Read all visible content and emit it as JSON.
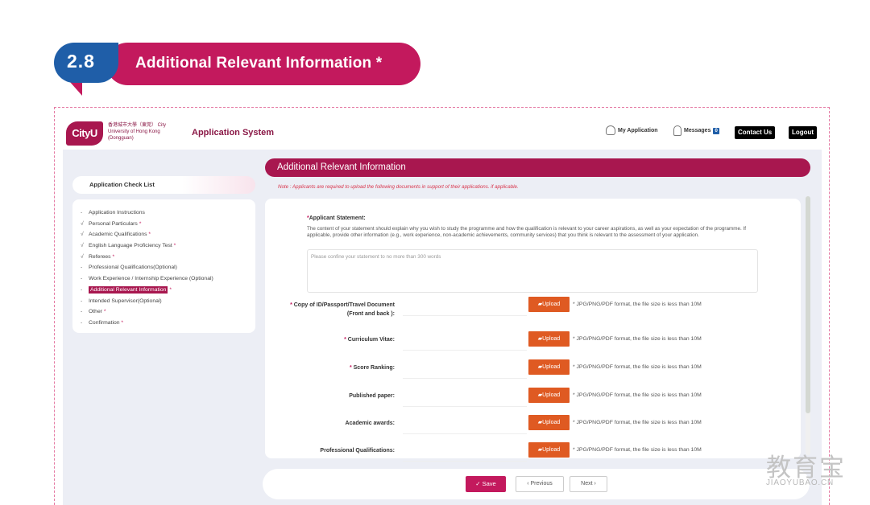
{
  "section": {
    "number": "2.8",
    "title": "Additional Relevant Information *"
  },
  "header": {
    "logo_text": "CityU",
    "logo_subtitle": "香港城市大學（東莞） City University of Hong Kong (Dongguan)",
    "app_title": "Application System",
    "my_application": "My Application",
    "messages": "Messages",
    "messages_count": "0",
    "contact_us": "Contact Us",
    "logout": "Logout"
  },
  "sidebar": {
    "title": "Application Check List",
    "items": [
      {
        "mark": "-",
        "label": "Application Instructions",
        "required": "",
        "active": false
      },
      {
        "mark": "√",
        "label": "Personal Particulars",
        "required": " *",
        "active": false
      },
      {
        "mark": "√",
        "label": "Academic Qualifications",
        "required": " *",
        "active": false
      },
      {
        "mark": "√",
        "label": "English Language Proficiency Test",
        "required": " *",
        "active": false
      },
      {
        "mark": "√",
        "label": "Referees",
        "required": " *",
        "active": false
      },
      {
        "mark": "-",
        "label": "Professional Qualifications(Optional)",
        "required": "",
        "active": false
      },
      {
        "mark": "-",
        "label": "Work Experience / Internship Experience (Optional)",
        "required": "",
        "active": false
      },
      {
        "mark": "-",
        "label": "Additional Relevant Information",
        "required": " *",
        "active": true
      },
      {
        "mark": "-",
        "label": "Intended Supervisor(Optional)",
        "required": "",
        "active": false
      },
      {
        "mark": "-",
        "label": "Other",
        "required": " *",
        "active": false
      },
      {
        "mark": "-",
        "label": "Confirmation",
        "required": " *",
        "active": false
      }
    ]
  },
  "panel": {
    "title": "Additional Relevant Information",
    "note": "Note : Applicants are required to upload the following documents in support of their applications.   if applicable.",
    "statement_label": "Applicant Statement:",
    "statement_required": "*",
    "statement_desc": "The content of your statement should explain why you wish to study the programme and how the qualification is relevant to your career aspirations, as well as your expectation of the programme. If applicable, provide other information (e.g., work experience, non-academic achievements, community services) that you think is relevant to the assessment of your application.",
    "statement_placeholder": "Please confine your statement to no more than 300 words",
    "upload_label": "Upload",
    "upload_hint": "* JPG/PNG/PDF format, the file size is less than 10M",
    "uploads": [
      {
        "label_line1": "Copy of ID/Passport/Travel Document",
        "label_line2": "(Front and back ):",
        "required": "* "
      },
      {
        "label_line1": "Curriculum Vitae:",
        "label_line2": "",
        "required": "* "
      },
      {
        "label_line1": "Score Ranking:",
        "label_line2": "",
        "required": "* "
      },
      {
        "label_line1": "Published paper:",
        "label_line2": "",
        "required": ""
      },
      {
        "label_line1": "Academic awards:",
        "label_line2": "",
        "required": ""
      },
      {
        "label_line1": "Professional Qualifications:",
        "label_line2": "",
        "required": ""
      }
    ]
  },
  "footer": {
    "save": "Save",
    "previous": "Previous",
    "next": "Next"
  },
  "watermark": {
    "main": "教育宝",
    "sub": "JIAOYUBAO.CN"
  },
  "colors": {
    "brand_magenta": "#c3195d",
    "brand_dark": "#a8174f",
    "brand_blue": "#1f5ea8",
    "upload_orange": "#df5a22"
  }
}
